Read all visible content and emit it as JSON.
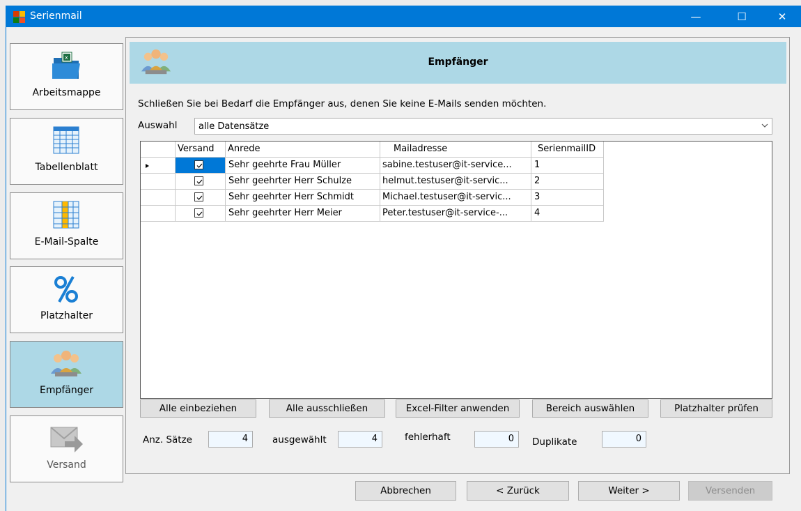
{
  "window": {
    "title": "Serienmail",
    "controls": [
      "—",
      "☐",
      "✕"
    ]
  },
  "nav": [
    {
      "label": "Arbeitsmappe",
      "icon": "workbook-folder-icon",
      "active": false
    },
    {
      "label": "Tabellenblatt",
      "icon": "spreadsheet-icon",
      "active": false
    },
    {
      "label": "E-Mail-Spalte",
      "icon": "email-column-icon",
      "active": false
    },
    {
      "label": "Platzhalter",
      "icon": "percent-icon",
      "active": false
    },
    {
      "label": "Empfänger",
      "icon": "recipients-icon",
      "active": true
    },
    {
      "label": "Versand",
      "icon": "send-mail-icon",
      "active": false
    }
  ],
  "header": {
    "title": "Empfänger"
  },
  "intro": "Schließen Sie bei Bedarf die Empfänger aus, denen Sie keine E-Mails senden möchten.",
  "auswahl": {
    "label": "Auswahl",
    "value": "alle Datensätze"
  },
  "grid": {
    "columns": [
      "Versand",
      "Anrede",
      "Mailadresse",
      "SerienmailID"
    ],
    "rows": [
      {
        "versand": true,
        "anrede": "Sehr geehrte Frau Müller",
        "mail": "sabine.testuser@it-service...",
        "id": "1"
      },
      {
        "versand": true,
        "anrede": "Sehr geehrter Herr Schulze",
        "mail": "helmut.testuser@it-servic...",
        "id": "2"
      },
      {
        "versand": true,
        "anrede": "Sehr geehrter Herr Schmidt",
        "mail": "Michael.testuser@it-servic...",
        "id": "3"
      },
      {
        "versand": true,
        "anrede": "Sehr geehrter Herr Meier",
        "mail": "Peter.testuser@it-service-...",
        "id": "4"
      }
    ]
  },
  "actions": {
    "include_all": "Alle einbeziehen",
    "exclude_all": "Alle ausschließen",
    "excel_filter": "Excel-Filter anwenden",
    "select_range": "Bereich auswählen",
    "check_placeholders": "Platzhalter prüfen"
  },
  "stats": {
    "count_label": "Anz. Sätze",
    "count": "4",
    "selected_label": "ausgewählt",
    "selected": "4",
    "errors_label": "fehlerhaft",
    "errors": "0",
    "duplicates_label": "Duplikate",
    "duplicates": "0"
  },
  "footer": {
    "cancel": "Abbrechen",
    "back": "< Zurück",
    "next": "Weiter >",
    "send": "Versenden"
  },
  "colors": {
    "accent": "#0078d7",
    "header_band": "#add8e6",
    "selection": "#0078d7"
  }
}
